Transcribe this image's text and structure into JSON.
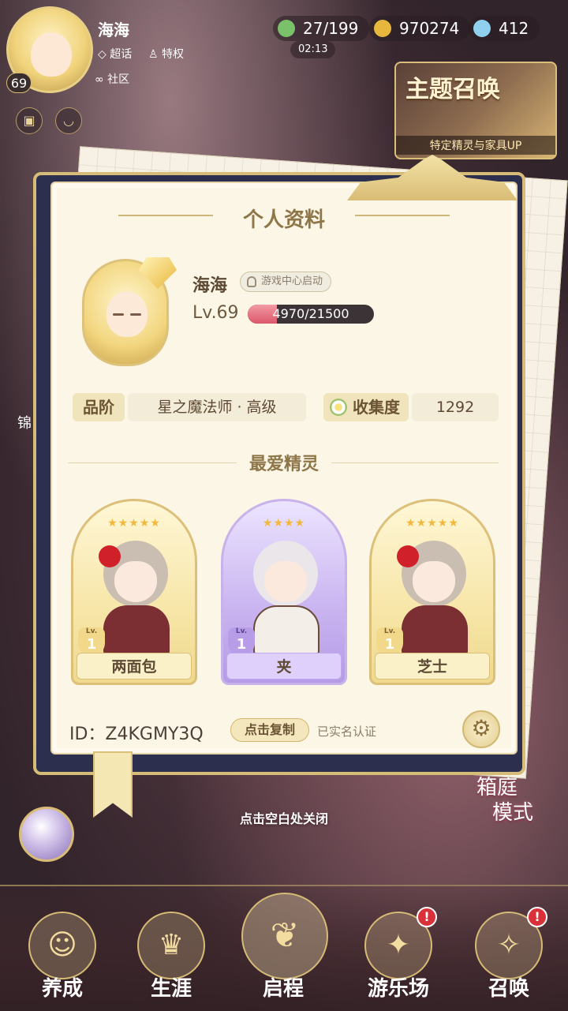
{
  "hud": {
    "player_name": "海海",
    "level": "69",
    "tags": [
      "超话",
      "特权",
      "社区"
    ],
    "resources": [
      {
        "icon": "clover-icon",
        "value": "27/199",
        "color": "#7bc06a"
      },
      {
        "icon": "gold-coin-icon",
        "value": "970274",
        "color": "#e7b63d"
      },
      {
        "icon": "crystal-icon",
        "value": "412",
        "color": "#8fd0ef"
      }
    ],
    "timer": "02:13"
  },
  "banner": {
    "title": "主题召唤",
    "subtitle": "特定精灵与家具UP"
  },
  "side": {
    "home_mode_line1": "箱庭",
    "home_mode_line2": "模式",
    "left_label": "锦"
  },
  "profile": {
    "title": "个人资料",
    "name": "海海",
    "status": "游戏中心启动",
    "level_text": "Lv.69",
    "xp_text": "4970/21500",
    "xp_current": 4970,
    "xp_max": 21500,
    "rank_label": "品阶",
    "rank_value": "星之魔法师 · 高级",
    "collection_label": "收集度",
    "collection_value": "1292",
    "favorites_title": "最爱精灵",
    "favorites": [
      {
        "name": "两面包",
        "level": "1",
        "stars": "★★★★★",
        "frame": "gold"
      },
      {
        "name": "夹",
        "level": "1",
        "stars": "★★★★",
        "frame": "purple"
      },
      {
        "name": "芝士",
        "level": "1",
        "stars": "★★★★★",
        "frame": "gold"
      }
    ],
    "lv_caption": "Lv.",
    "id_text": "ID：Z4KGMY3Q",
    "copy_label": "点击复制",
    "verified": "已实名认证"
  },
  "close_hint": "点击空白处关闭",
  "nav": {
    "items": [
      {
        "label": "养成",
        "icon": "girl-portrait-icon",
        "badge": ""
      },
      {
        "label": "生涯",
        "icon": "crown-icon",
        "badge": ""
      },
      {
        "label": "启程",
        "icon": "book-butterfly-icon",
        "badge": ""
      },
      {
        "label": "游乐场",
        "icon": "star-crest-icon",
        "badge": "!"
      },
      {
        "label": "召唤",
        "icon": "card-star-icon",
        "badge": "!"
      }
    ]
  }
}
